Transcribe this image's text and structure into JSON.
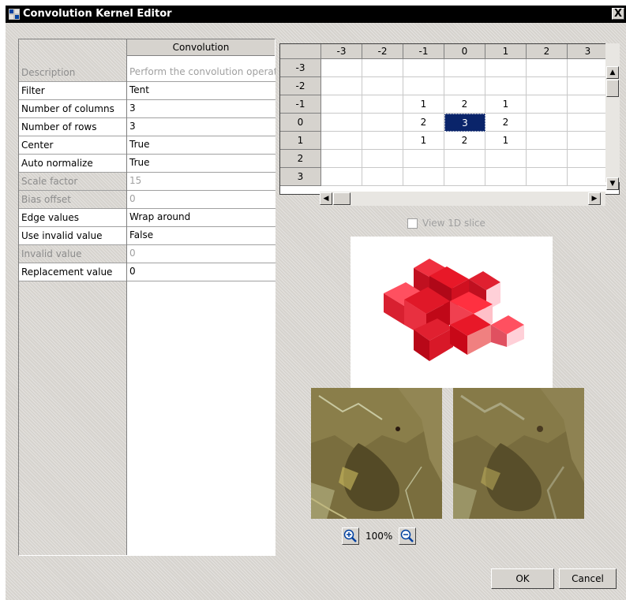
{
  "window": {
    "title": "Convolution Kernel Editor",
    "close_label": "X"
  },
  "properties": {
    "header": "Convolution",
    "rows": [
      {
        "name": "Description",
        "value": "Perform the convolution operation",
        "disabled": true
      },
      {
        "name": "Filter",
        "value": "Tent",
        "disabled": false
      },
      {
        "name": "Number of columns",
        "value": "3",
        "disabled": false
      },
      {
        "name": "Number of rows",
        "value": "3",
        "disabled": false
      },
      {
        "name": "Center",
        "value": "True",
        "disabled": false
      },
      {
        "name": "Auto normalize",
        "value": "True",
        "disabled": false
      },
      {
        "name": "Scale factor",
        "value": "15",
        "disabled": true
      },
      {
        "name": "Bias offset",
        "value": "0",
        "disabled": true
      },
      {
        "name": "Edge values",
        "value": "Wrap around",
        "disabled": false
      },
      {
        "name": "Use invalid value",
        "value": "False",
        "disabled": false
      },
      {
        "name": "Invalid value",
        "value": "0",
        "disabled": true
      },
      {
        "name": "Replacement value",
        "value": "0",
        "disabled": false
      }
    ]
  },
  "kernel": {
    "col_headers": [
      "-3",
      "-2",
      "-1",
      "0",
      "1",
      "2",
      "3"
    ],
    "row_headers": [
      "-3",
      "-2",
      "-1",
      "0",
      "1",
      "2",
      "3"
    ],
    "cells": [
      [
        "",
        "",
        "",
        "",
        "",
        "",
        ""
      ],
      [
        "",
        "",
        "",
        "",
        "",
        "",
        ""
      ],
      [
        "",
        "",
        "1",
        "2",
        "1",
        "",
        ""
      ],
      [
        "",
        "",
        "2",
        "3",
        "2",
        "",
        ""
      ],
      [
        "",
        "",
        "1",
        "2",
        "1",
        "",
        ""
      ],
      [
        "",
        "",
        "",
        "",
        "",
        "",
        ""
      ],
      [
        "",
        "",
        "",
        "",
        "",
        "",
        ""
      ]
    ],
    "selected": {
      "row": 3,
      "col": 3
    }
  },
  "view_1d_slice": {
    "label": "View 1D slice",
    "checked": false,
    "enabled": false
  },
  "zoom": {
    "level": "100%"
  },
  "buttons": {
    "ok": "OK",
    "cancel": "Cancel"
  },
  "colors": {
    "selection": "#0a246a",
    "title_bar": "#000000",
    "face": "#d6d3ce",
    "kernel_red": "#d41020"
  }
}
